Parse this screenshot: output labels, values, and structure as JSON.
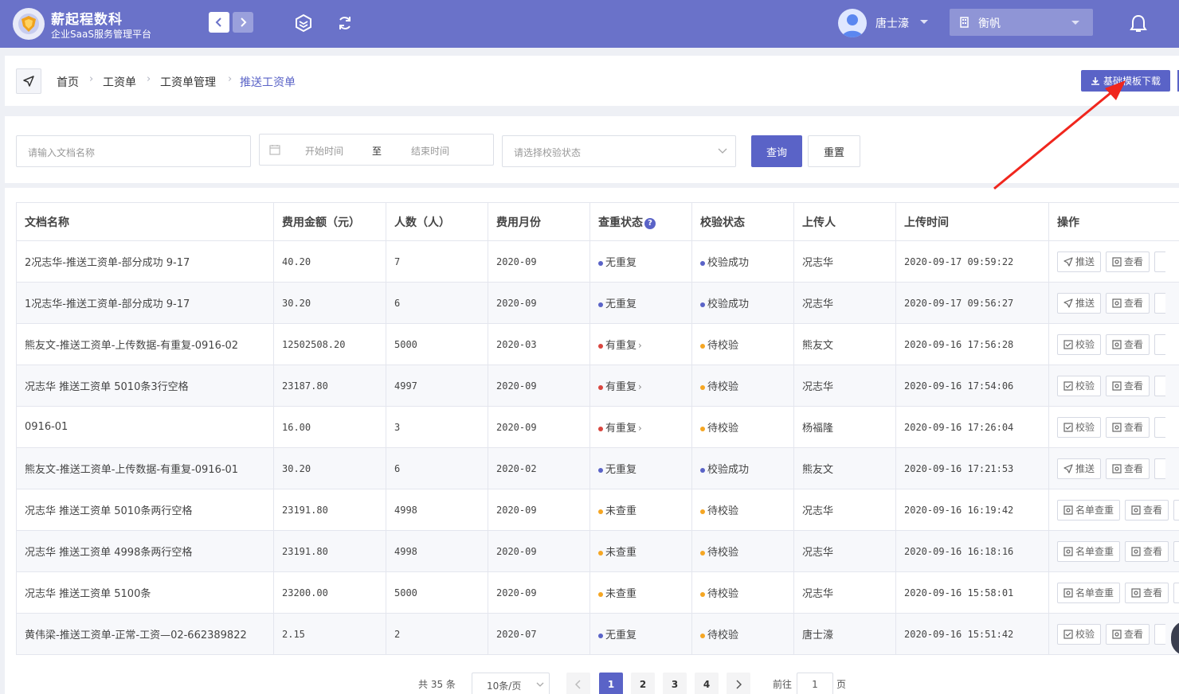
{
  "header": {
    "app_title": "薪起程数科",
    "app_subtitle": "企业SaaS服务管理平台",
    "user_name": "唐士濠",
    "org_name": "衡帆",
    "colors": {
      "primary": "#6a72c9",
      "accent": "#5a63c7"
    }
  },
  "breadcrumb": {
    "items": [
      "首页",
      "工资单",
      "工资单管理",
      "推送工资单"
    ],
    "download_button": "基础模板下载"
  },
  "filters": {
    "name_placeholder": "请输入文档名称",
    "date_start_placeholder": "开始时间",
    "date_separator": "至",
    "date_end_placeholder": "结束时间",
    "status_placeholder": "请选择校验状态",
    "query_button": "查询",
    "reset_button": "重置"
  },
  "table": {
    "columns": [
      "文档名称",
      "费用金额（元）",
      "人数（人）",
      "费用月份",
      "查重状态",
      "校验状态",
      "上传人",
      "上传时间",
      "操作"
    ],
    "rows": [
      {
        "name": "2况志华-推送工资单-部分成功 9-17",
        "amount": "40.20",
        "people": "7",
        "month": "2020-09",
        "dup_status": "无重复",
        "dup_color": "#5a63c7",
        "dup_link": false,
        "check_status": "校验成功",
        "check_color": "#5a63c7",
        "uploader": "况志华",
        "time": "2020-09-17 09:59:22",
        "ops": [
          "推送",
          "查看"
        ]
      },
      {
        "name": "1况志华-推送工资单-部分成功 9-17",
        "amount": "30.20",
        "people": "6",
        "month": "2020-09",
        "dup_status": "无重复",
        "dup_color": "#5a63c7",
        "dup_link": false,
        "check_status": "校验成功",
        "check_color": "#5a63c7",
        "uploader": "况志华",
        "time": "2020-09-17 09:56:27",
        "ops": [
          "推送",
          "查看"
        ]
      },
      {
        "name": "熊友文-推送工资单-上传数据-有重复-0916-02",
        "amount": "12502508.20",
        "people": "5000",
        "month": "2020-03",
        "dup_status": "有重复",
        "dup_color": "#d9463f",
        "dup_link": true,
        "check_status": "待校验",
        "check_color": "#f5a623",
        "uploader": "熊友文",
        "time": "2020-09-16 17:56:28",
        "ops": [
          "校验",
          "查看"
        ]
      },
      {
        "name": "况志华 推送工资单 5010条3行空格",
        "amount": "23187.80",
        "people": "4997",
        "month": "2020-09",
        "dup_status": "有重复",
        "dup_color": "#d9463f",
        "dup_link": true,
        "check_status": "待校验",
        "check_color": "#f5a623",
        "uploader": "况志华",
        "time": "2020-09-16 17:54:06",
        "ops": [
          "校验",
          "查看"
        ]
      },
      {
        "name": "0916-01",
        "amount": "16.00",
        "people": "3",
        "month": "2020-09",
        "dup_status": "有重复",
        "dup_color": "#d9463f",
        "dup_link": true,
        "check_status": "待校验",
        "check_color": "#f5a623",
        "uploader": "杨福隆",
        "time": "2020-09-16 17:26:04",
        "ops": [
          "校验",
          "查看"
        ]
      },
      {
        "name": "熊友文-推送工资单-上传数据-有重复-0916-01",
        "amount": "30.20",
        "people": "6",
        "month": "2020-02",
        "dup_status": "无重复",
        "dup_color": "#5a63c7",
        "dup_link": false,
        "check_status": "校验成功",
        "check_color": "#5a63c7",
        "uploader": "熊友文",
        "time": "2020-09-16 17:21:53",
        "ops": [
          "推送",
          "查看"
        ]
      },
      {
        "name": "况志华 推送工资单 5010条两行空格",
        "amount": "23191.80",
        "people": "4998",
        "month": "2020-09",
        "dup_status": "未查重",
        "dup_color": "#f5a623",
        "dup_link": false,
        "check_status": "待校验",
        "check_color": "#f5a623",
        "uploader": "况志华",
        "time": "2020-09-16 16:19:42",
        "ops": [
          "名单查重",
          "查看"
        ]
      },
      {
        "name": "况志华 推送工资单 4998条两行空格",
        "amount": "23191.80",
        "people": "4998",
        "month": "2020-09",
        "dup_status": "未查重",
        "dup_color": "#f5a623",
        "dup_link": false,
        "check_status": "待校验",
        "check_color": "#f5a623",
        "uploader": "况志华",
        "time": "2020-09-16 16:18:16",
        "ops": [
          "名单查重",
          "查看"
        ]
      },
      {
        "name": "况志华 推送工资单 5100条",
        "amount": "23200.00",
        "people": "5000",
        "month": "2020-09",
        "dup_status": "未查重",
        "dup_color": "#f5a623",
        "dup_link": false,
        "check_status": "待校验",
        "check_color": "#f5a623",
        "uploader": "况志华",
        "time": "2020-09-16 15:58:01",
        "ops": [
          "名单查重",
          "查看"
        ]
      },
      {
        "name": "黄伟梁-推送工资单-正常-工资—02-662389822",
        "amount": "2.15",
        "people": "2",
        "month": "2020-07",
        "dup_status": "无重复",
        "dup_color": "#5a63c7",
        "dup_link": false,
        "check_status": "待校验",
        "check_color": "#f5a623",
        "uploader": "唐士濠",
        "time": "2020-09-16 15:51:42",
        "ops": [
          "校验",
          "查看"
        ]
      }
    ]
  },
  "pagination": {
    "total_label": "共 35 条",
    "page_size": "10条/页",
    "pages": [
      "1",
      "2",
      "3",
      "4"
    ],
    "current_page": "1",
    "goto_label": "前往",
    "goto_value": "1",
    "page_unit": "页"
  }
}
